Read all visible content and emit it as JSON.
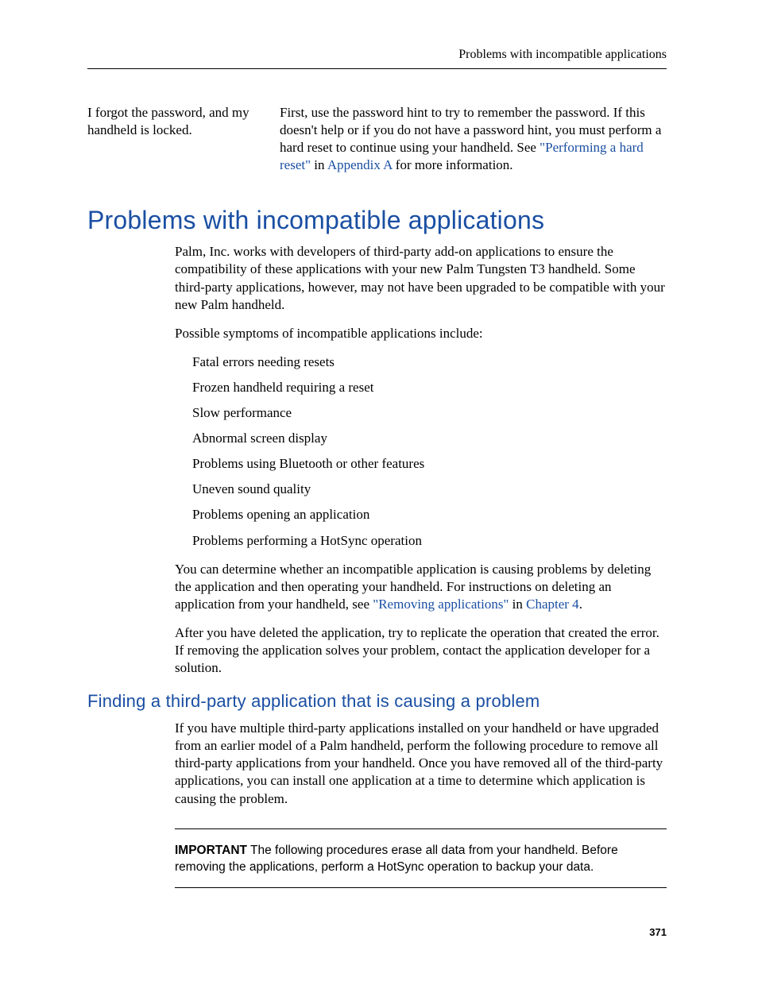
{
  "running_header": "Problems with incompatible applications",
  "qa": {
    "question": "I forgot the password, and my handheld is locked.",
    "answer_pre": "First, use the password hint to try to remember the password. If this doesn't help or if you do not have a password hint, you must perform a hard reset to continue using your handheld. See ",
    "link1": "\"Performing a hard reset\"",
    "answer_mid": " in ",
    "link2": "Appendix A",
    "answer_post": " for more information."
  },
  "h1": "Problems with incompatible applications",
  "p1": "Palm, Inc. works with developers of third-party add-on applications to ensure the compatibility of these applications with your new Palm Tungsten T3 handheld. Some third-party applications, however, may not have been upgraded to be compatible with your new Palm handheld.",
  "p2": "Possible symptoms of incompatible applications include:",
  "bullets": [
    "Fatal errors needing resets",
    "Frozen handheld requiring a reset",
    "Slow performance",
    "Abnormal screen display",
    "Problems using Bluetooth or other features",
    "Uneven sound quality",
    "Problems opening an application",
    "Problems performing a HotSync operation"
  ],
  "p3_pre": "You can determine whether an incompatible application is causing problems by deleting the application and then operating your handheld. For instructions on deleting an application from your handheld, see ",
  "p3_link1": "\"Removing applications\"",
  "p3_mid": " in ",
  "p3_link2": "Chapter 4",
  "p3_post": ".",
  "p4": "After you have deleted the application, try to replicate the operation that created the error. If removing the application solves your problem, contact the application developer for a solution.",
  "h2": "Finding a third-party application that is causing a problem",
  "p5": "If you have multiple third-party applications installed on your handheld or have upgraded from an earlier model of a Palm handheld, perform the following procedure to remove all third-party applications from your handheld. Once you have removed all of the third-party applications, you can install one application at a time to determine which application is causing the problem.",
  "important_label": "IMPORTANT",
  "important_text": " The following procedures erase all data from your handheld. Before removing the applications, perform a HotSync operation to backup your data.",
  "page_number": "371"
}
